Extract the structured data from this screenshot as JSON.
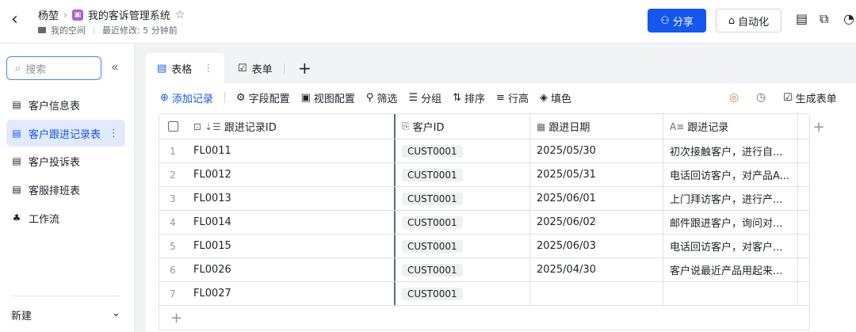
{
  "header": {
    "back_icon": "chevron-left-icon",
    "workspace": "杨堃",
    "app_name": "我的客诉管理系统",
    "space": "我的空间",
    "last_modified": "最近修改: 5 分钟前",
    "share_label": "分享",
    "automation_label": "自动化"
  },
  "sidebar": {
    "search_placeholder": "搜索",
    "items": [
      {
        "label": "客户信息表",
        "icon": "table-icon",
        "active": false
      },
      {
        "label": "客户跟进记录表",
        "icon": "table-icon",
        "active": true
      },
      {
        "label": "客户投诉表",
        "icon": "table-icon",
        "active": false
      },
      {
        "label": "客服排班表",
        "icon": "table-icon",
        "active": false
      },
      {
        "label": "工作流",
        "icon": "workflow-icon",
        "active": false
      }
    ],
    "footer_label": "新建"
  },
  "tabs": [
    {
      "label": "表格",
      "active": true
    },
    {
      "label": "表单",
      "active": false
    }
  ],
  "toolbar": {
    "add_record": "添加记录",
    "field_config": "字段配置",
    "view_config": "视图配置",
    "filter": "筛选",
    "group": "分组",
    "sort": "排序",
    "row_height": "行高",
    "fill_color": "填色",
    "generate_form": "生成表单"
  },
  "table": {
    "columns": [
      "跟进记录ID",
      "客户ID",
      "跟进日期",
      "跟进记录"
    ],
    "rows": [
      {
        "idx": "1",
        "id": "FL0011",
        "cust": "CUST0001",
        "date": "2025/05/30",
        "rec": "初次接触客户，进行自..."
      },
      {
        "idx": "2",
        "id": "FL0012",
        "cust": "CUST0001",
        "date": "2025/05/31",
        "rec": "电话回访客户，对产品A..."
      },
      {
        "idx": "3",
        "id": "FL0013",
        "cust": "CUST0001",
        "date": "2025/06/01",
        "rec": "上门拜访客户，进行产..."
      },
      {
        "idx": "4",
        "id": "FL0014",
        "cust": "CUST0001",
        "date": "2025/06/02",
        "rec": "邮件跟进客户，询问对..."
      },
      {
        "idx": "5",
        "id": "FL0015",
        "cust": "CUST0001",
        "date": "2025/06/03",
        "rec": "电话回访客户，对客户..."
      },
      {
        "idx": "6",
        "id": "FL0026",
        "cust": "CUST0001",
        "date": "2025/04/30",
        "rec": "客户说最近产品用起来..."
      },
      {
        "idx": "7",
        "id": "FL0027",
        "cust": "CUST0001",
        "date": "",
        "rec": ""
      }
    ]
  },
  "colors": {
    "accent": "#1456f0",
    "active_bg": "#e1eaff"
  }
}
